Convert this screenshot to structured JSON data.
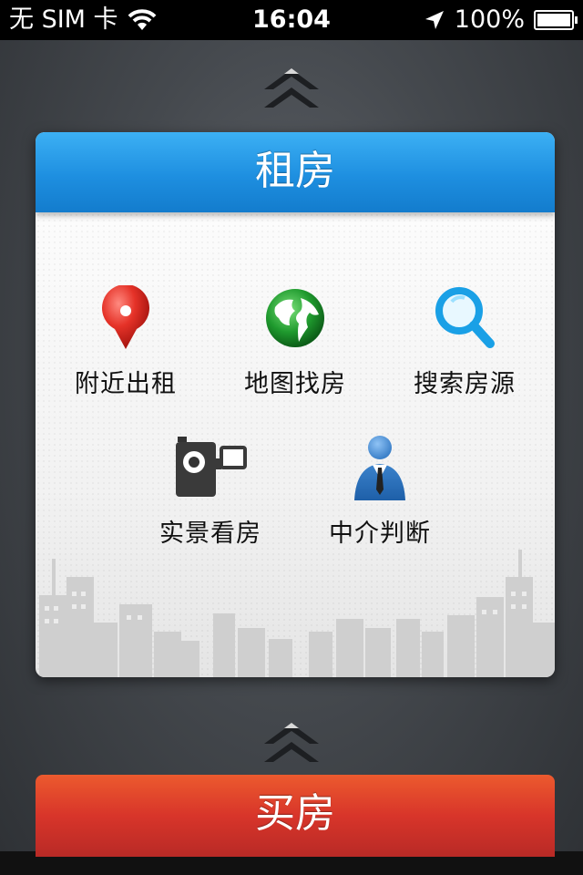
{
  "status_bar": {
    "carrier": "无 SIM 卡",
    "time": "16:04",
    "battery": "100%"
  },
  "card": {
    "title": "租房",
    "items": [
      {
        "label": "附近出租",
        "icon": "location-pin-icon"
      },
      {
        "label": "地图找房",
        "icon": "globe-icon"
      },
      {
        "label": "搜索房源",
        "icon": "magnifier-icon"
      },
      {
        "label": "实景看房",
        "icon": "video-camera-icon"
      },
      {
        "label": "中介判断",
        "icon": "agent-person-icon"
      }
    ]
  },
  "buy_button": {
    "label": "买房"
  },
  "colors": {
    "header_blue": "#1e8fe0",
    "buy_red": "#d8352a",
    "status_bar": "#000000"
  }
}
